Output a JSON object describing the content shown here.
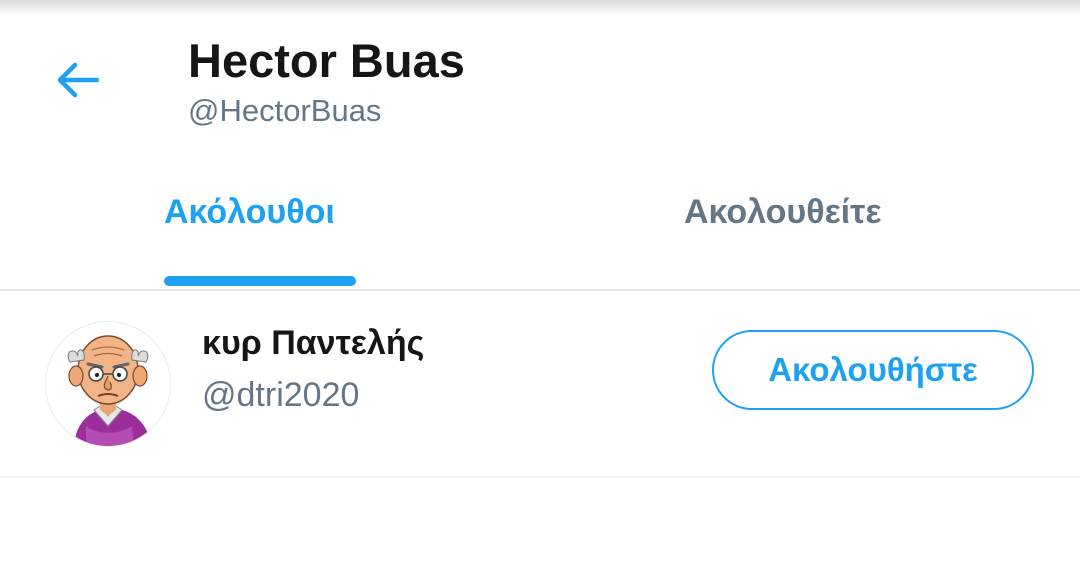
{
  "header": {
    "back_icon": "arrow-left-icon",
    "title": "Hector Buas",
    "handle": "@HectorBuas"
  },
  "tabs": [
    {
      "label": "Ακόλουθοι",
      "selected": true
    },
    {
      "label": "Ακολουθείτε",
      "selected": false
    }
  ],
  "users": [
    {
      "name": "κυρ Παντελής",
      "handle": "@dtri2020",
      "avatar_icon": "cartoon-old-man-avatar",
      "follow_label": "Ακολουθήστε"
    }
  ],
  "colors": {
    "accent": "#1da1f2",
    "text_primary": "#14171a",
    "text_secondary": "#657786",
    "divider": "#e1e8ed"
  }
}
